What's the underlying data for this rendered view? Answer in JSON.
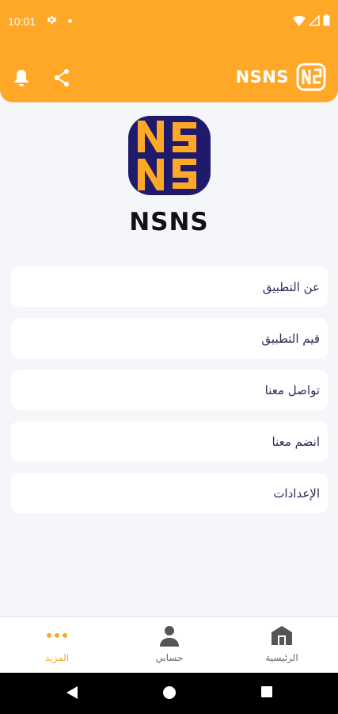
{
  "status_bar": {
    "time": "10:01"
  },
  "app_bar": {
    "brand": "NSNS"
  },
  "logo": {
    "name": "NSNS"
  },
  "menu": [
    {
      "label": "عن التطبيق"
    },
    {
      "label": "قيم التطبيق"
    },
    {
      "label": "تواصل معنا"
    },
    {
      "label": "انضم معنا"
    },
    {
      "label": "الإعدادات"
    }
  ],
  "bottom_nav": {
    "more": "المزيد",
    "account": "حسابي",
    "home": "الرئيسية"
  },
  "colors": {
    "accent": "#ffa726",
    "logo_navy": "#1f1a6b",
    "text": "#2d2d5a"
  }
}
